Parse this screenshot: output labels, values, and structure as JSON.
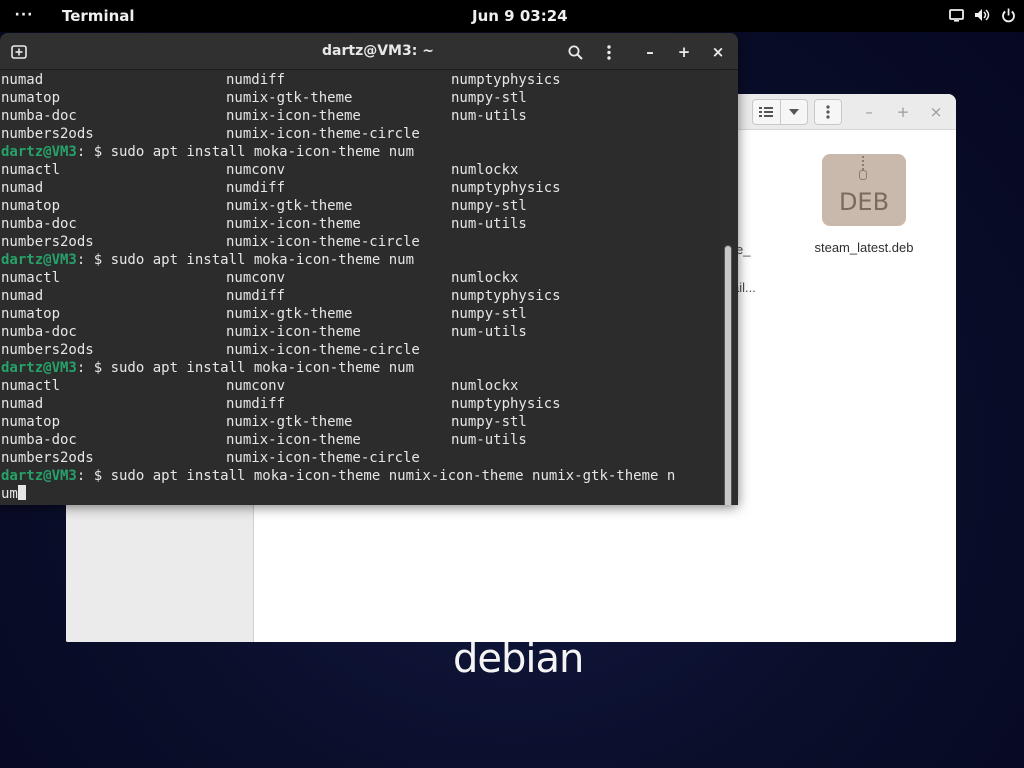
{
  "topbar": {
    "activities_label": "···",
    "app_name": "Terminal",
    "clock": "Jun 9  03:24"
  },
  "desktop": {
    "logo_text": "debian"
  },
  "files": {
    "deb_icon_label": "DEB",
    "file_name": "steam_latest.deb",
    "partial_1": "e_",
    "partial_2": "ail..."
  },
  "terminal": {
    "title": "dartz@VM3: ~",
    "prompt_user": "dartz@VM3",
    "prompt_rest": ": $ ",
    "lines": [
      {
        "type": "cols",
        "cols": [
          "numad",
          "numdiff",
          "numptyphysics"
        ]
      },
      {
        "type": "cols",
        "cols": [
          "numatop",
          "numix-gtk-theme",
          "numpy-stl"
        ]
      },
      {
        "type": "cols",
        "cols": [
          "numba-doc",
          "numix-icon-theme",
          "num-utils"
        ]
      },
      {
        "type": "cols",
        "cols": [
          "numbers2ods",
          "numix-icon-theme-circle",
          ""
        ]
      },
      {
        "type": "prompt",
        "cmd": "sudo apt install moka-icon-theme num"
      },
      {
        "type": "cols",
        "cols": [
          "numactl",
          "numconv",
          "numlockx"
        ]
      },
      {
        "type": "cols",
        "cols": [
          "numad",
          "numdiff",
          "numptyphysics"
        ]
      },
      {
        "type": "cols",
        "cols": [
          "numatop",
          "numix-gtk-theme",
          "numpy-stl"
        ]
      },
      {
        "type": "cols",
        "cols": [
          "numba-doc",
          "numix-icon-theme",
          "num-utils"
        ]
      },
      {
        "type": "cols",
        "cols": [
          "numbers2ods",
          "numix-icon-theme-circle",
          ""
        ]
      },
      {
        "type": "prompt",
        "cmd": "sudo apt install moka-icon-theme num"
      },
      {
        "type": "cols",
        "cols": [
          "numactl",
          "numconv",
          "numlockx"
        ]
      },
      {
        "type": "cols",
        "cols": [
          "numad",
          "numdiff",
          "numptyphysics"
        ]
      },
      {
        "type": "cols",
        "cols": [
          "numatop",
          "numix-gtk-theme",
          "numpy-stl"
        ]
      },
      {
        "type": "cols",
        "cols": [
          "numba-doc",
          "numix-icon-theme",
          "num-utils"
        ]
      },
      {
        "type": "cols",
        "cols": [
          "numbers2ods",
          "numix-icon-theme-circle",
          ""
        ]
      },
      {
        "type": "prompt",
        "cmd": "sudo apt install moka-icon-theme num"
      },
      {
        "type": "cols",
        "cols": [
          "numactl",
          "numconv",
          "numlockx"
        ]
      },
      {
        "type": "cols",
        "cols": [
          "numad",
          "numdiff",
          "numptyphysics"
        ]
      },
      {
        "type": "cols",
        "cols": [
          "numatop",
          "numix-gtk-theme",
          "numpy-stl"
        ]
      },
      {
        "type": "cols",
        "cols": [
          "numba-doc",
          "numix-icon-theme",
          "num-utils"
        ]
      },
      {
        "type": "cols",
        "cols": [
          "numbers2ods",
          "numix-icon-theme-circle",
          ""
        ]
      },
      {
        "type": "prompt",
        "cmd": "sudo apt install moka-icon-theme numix-icon-theme numix-gtk-theme n"
      },
      {
        "type": "input",
        "text": "um"
      }
    ]
  },
  "colors": {
    "prompt_green": "#26a269",
    "terminal_bg": "#2c2c2c",
    "topbar_bg": "#000000"
  }
}
